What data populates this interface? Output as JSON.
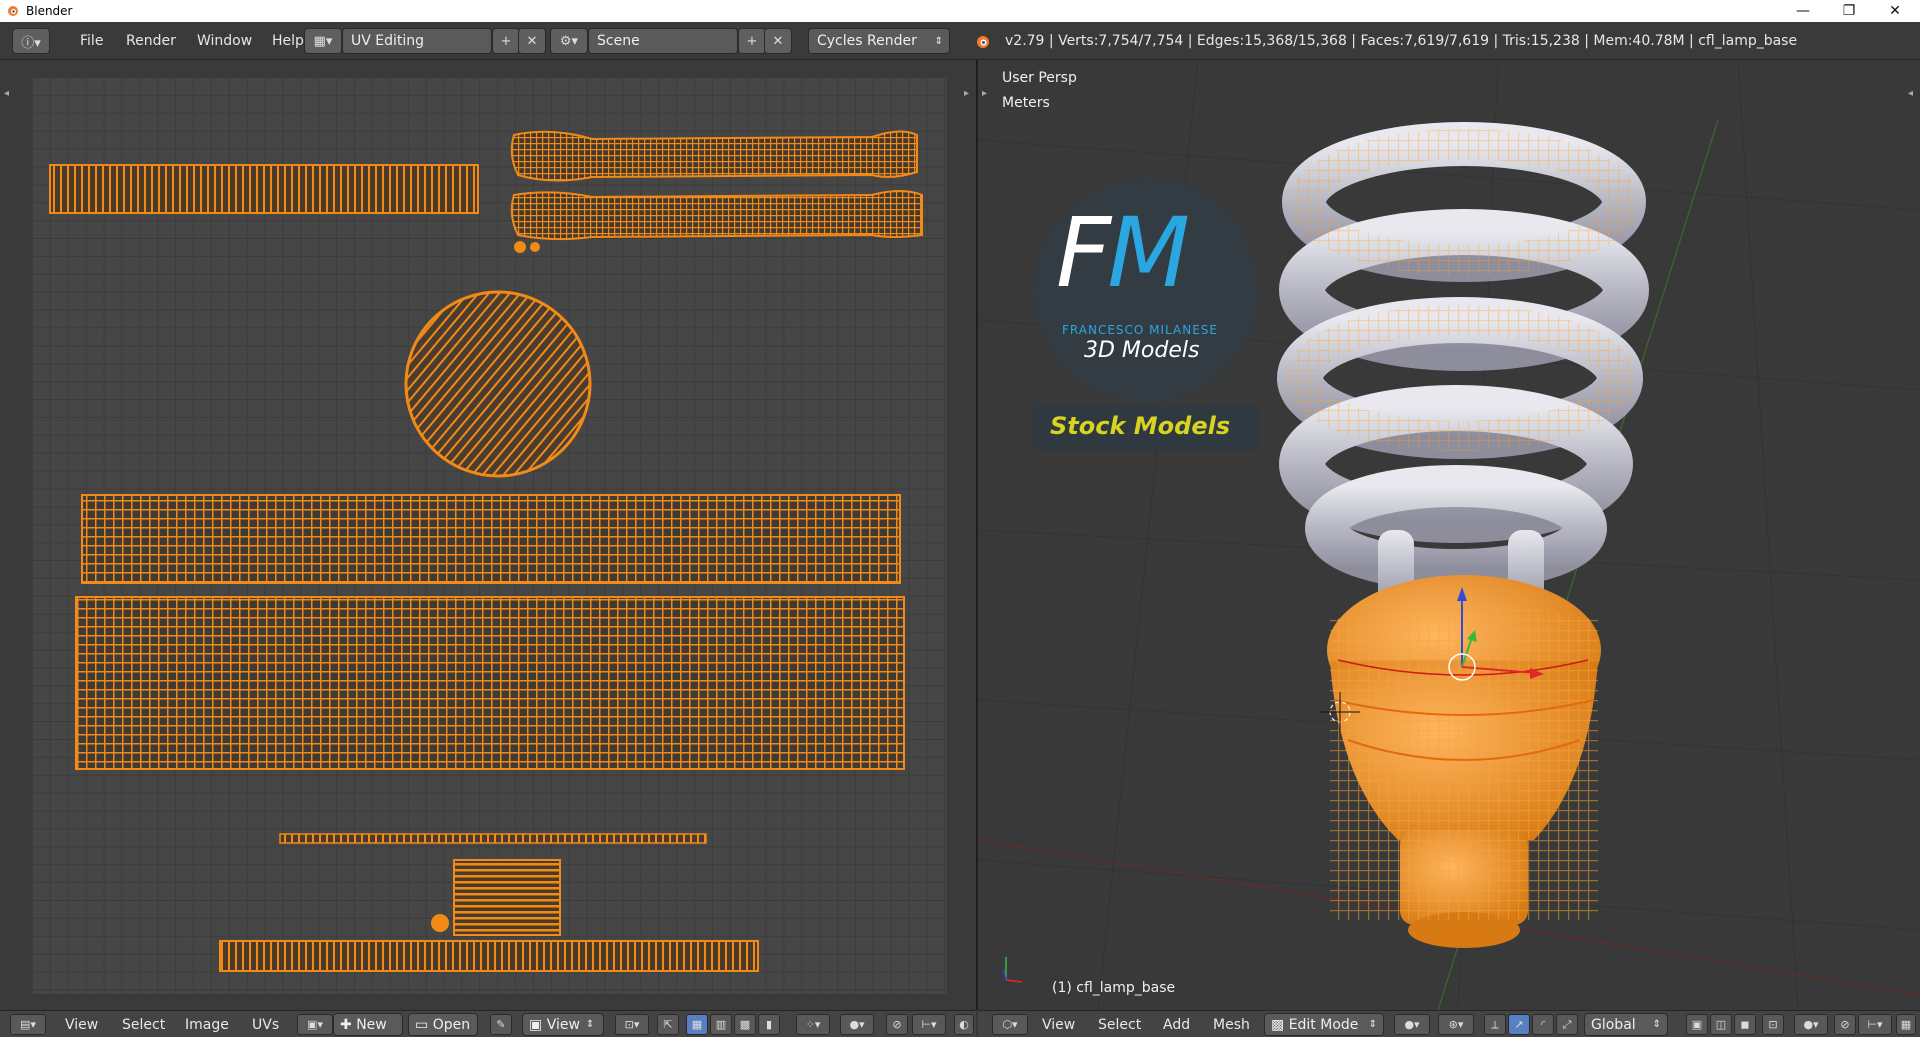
{
  "window": {
    "title": "Blender",
    "minimize": "—",
    "restore": "❐",
    "close": "✕"
  },
  "menu": {
    "file": "File",
    "render": "Render",
    "window": "Window",
    "help": "Help"
  },
  "layout": {
    "screen": "UV Editing",
    "scene": "Scene",
    "engine": "Cycles Render"
  },
  "stats": "v2.79 | Verts:7,754/7,754 | Edges:15,368/15,368 | Faces:7,619/7,619 | Tris:15,238 | Mem:40.78M | cfl_lamp_base",
  "viewport": {
    "persp": "User Persp",
    "units": "Meters",
    "object_label": "(1) cfl_lamp_base"
  },
  "logo": {
    "initial_f": "F",
    "initial_m": "M",
    "name": "FRANCESCO MILANESE",
    "tagline": "3D Models",
    "banner": "Stock Models"
  },
  "uv_header": {
    "view": "View",
    "select": "Select",
    "image": "Image",
    "uvs": "UVs",
    "new": "New",
    "open": "Open",
    "view2": "View"
  },
  "view3d_header": {
    "view": "View",
    "select": "Select",
    "add": "Add",
    "mesh": "Mesh",
    "mode": "Edit Mode",
    "orientation": "Global"
  },
  "colors": {
    "accent": "#f28a17",
    "header_bg": "#3a3a3a",
    "grid": "#464646",
    "logo_blue": "#2aa6e0",
    "logo_yellow": "#d8d320"
  },
  "icons": [
    "blender-logo-icon",
    "info-editor-icon",
    "screen-layout-icon",
    "scene-icon",
    "render-engine-icon",
    "axis-gizmo-icon",
    "cursor-icon"
  ]
}
